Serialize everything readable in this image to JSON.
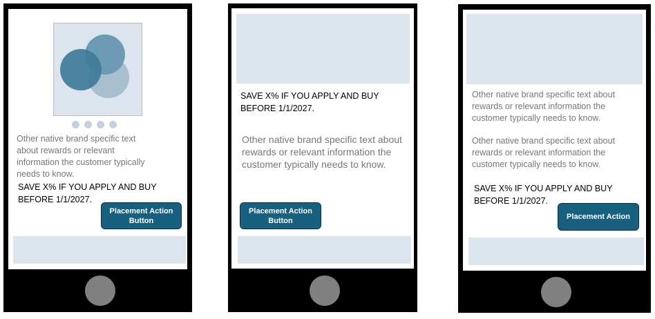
{
  "phones": [
    {
      "body_text": "Other native brand specific text about rewards or relevant information the customer typically needs to know.",
      "promo_text": "SAVE X% IF YOU APPLY AND BUY BEFORE 1/1/2027.",
      "button_label": "Placement Action Button",
      "carousel_dots": 4
    },
    {
      "promo_text": "SAVE X% IF YOU APPLY AND BUY BEFORE 1/1/2027.",
      "body_text": "Other native brand specific text about rewards or relevant information the customer typically needs to know.",
      "button_label": "Placement Action Button"
    },
    {
      "body_text_1": "Other native brand specific text about rewards or relevant information the customer typically needs to know.",
      "body_text_2": "Other native brand specific text about rewards or relevant information the customer typically needs to know.",
      "promo_text": "SAVE X% IF YOU APPLY AND BUY BEFORE 1/1/2027.",
      "button_label": "Placement Action"
    }
  ],
  "colors": {
    "phone_frame": "#000000",
    "placeholder": "#dce4ee",
    "button": "#17607f",
    "home_button": "#808080"
  }
}
